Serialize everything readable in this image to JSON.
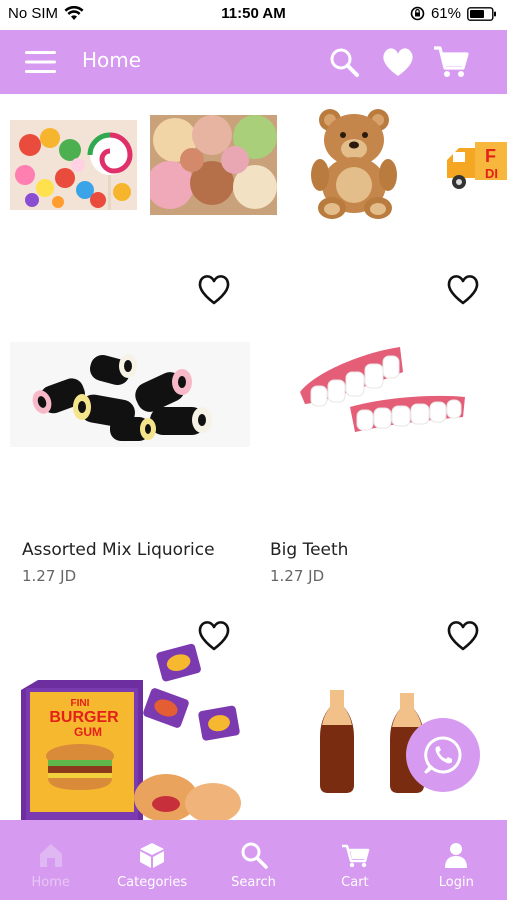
{
  "status_bar": {
    "carrier": "No SIM",
    "time": "11:50 AM",
    "battery": "61%"
  },
  "header": {
    "title": "Home"
  },
  "colors": {
    "accent": "#d69af0",
    "header_text": "#ffffff"
  },
  "categories": [
    {
      "name": "candy-category",
      "icon": "candy-image"
    },
    {
      "name": "ice-cream-category",
      "icon": "ice-cream-image"
    },
    {
      "name": "teddy-bear-category",
      "icon": "teddy-bear-image"
    },
    {
      "name": "delivery-category",
      "icon": "delivery-truck-image",
      "visible_text": "F DI"
    }
  ],
  "products": [
    {
      "name": "Assorted Mix Liquorice",
      "price": "1.27 JD"
    },
    {
      "name": "Big Teeth",
      "price": "1.27 JD"
    },
    {
      "name": "",
      "price": "",
      "image_text_1": "FINI",
      "image_text_2": "BURGER",
      "image_text_3": "GUM"
    },
    {
      "name": "",
      "price": ""
    }
  ],
  "bottom_nav": {
    "items": [
      {
        "label": "Home",
        "icon": "home-icon",
        "active": true
      },
      {
        "label": "Categories",
        "icon": "categories-icon",
        "active": false
      },
      {
        "label": "Search",
        "icon": "search-icon",
        "active": false
      },
      {
        "label": "Cart",
        "icon": "cart-icon",
        "active": false
      },
      {
        "label": "Login",
        "icon": "user-icon",
        "active": false
      }
    ]
  }
}
